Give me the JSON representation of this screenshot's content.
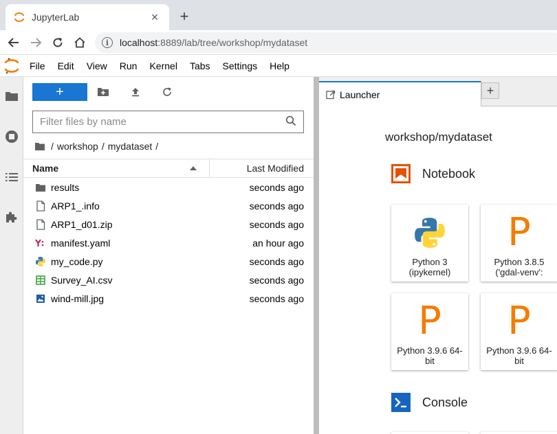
{
  "browser": {
    "tab_title": "JupyterLab",
    "close_glyph": "✕",
    "newtab_glyph": "+",
    "url_host": "localhost",
    "url_rest": ":8889/lab/tree/workshop/mydataset",
    "info_glyph": "i"
  },
  "menu": {
    "items": [
      "File",
      "Edit",
      "View",
      "Run",
      "Kernel",
      "Tabs",
      "Settings",
      "Help"
    ]
  },
  "filebrowser": {
    "new_glyph": "+",
    "filter_placeholder": "Filter files by name",
    "breadcrumb": [
      "/",
      "workshop",
      "/",
      "mydataset",
      "/"
    ],
    "col_name": "Name",
    "col_modified": "Last Modified",
    "files": [
      {
        "name": "results",
        "modified": "seconds ago",
        "icon": "folder-icon"
      },
      {
        "name": "ARP1_.info",
        "modified": "seconds ago",
        "icon": "file-icon"
      },
      {
        "name": "ARP1_d01.zip",
        "modified": "seconds ago",
        "icon": "file-icon"
      },
      {
        "name": "manifest.yaml",
        "modified": "an hour ago",
        "icon": "yaml-icon"
      },
      {
        "name": "my_code.py",
        "modified": "seconds ago",
        "icon": "python-icon"
      },
      {
        "name": "Survey_AI.csv",
        "modified": "seconds ago",
        "icon": "spreadsheet-icon"
      },
      {
        "name": "wind-mill.jpg",
        "modified": "seconds ago",
        "icon": "image-icon"
      }
    ]
  },
  "launcher": {
    "tab_label": "Launcher",
    "addtab_glyph": "+",
    "path": "workshop/mydataset",
    "notebook_title": "Notebook",
    "console_title": "Console",
    "p_glyph": "P",
    "kernels": [
      {
        "line1": "Python 3",
        "line2": "(ipykernel)"
      },
      {
        "line1": "Python 3.8.5",
        "line2": "('gdal-venv':"
      },
      {
        "line1": "Python 3.9.6 64-",
        "line2": "bit"
      },
      {
        "line1": "Python 3.9.6 64-",
        "line2": "bit"
      }
    ]
  },
  "colors": {
    "accent": "#1976d2",
    "jupyter_orange": "#f57c00",
    "notebook_icon": "#e65100"
  }
}
